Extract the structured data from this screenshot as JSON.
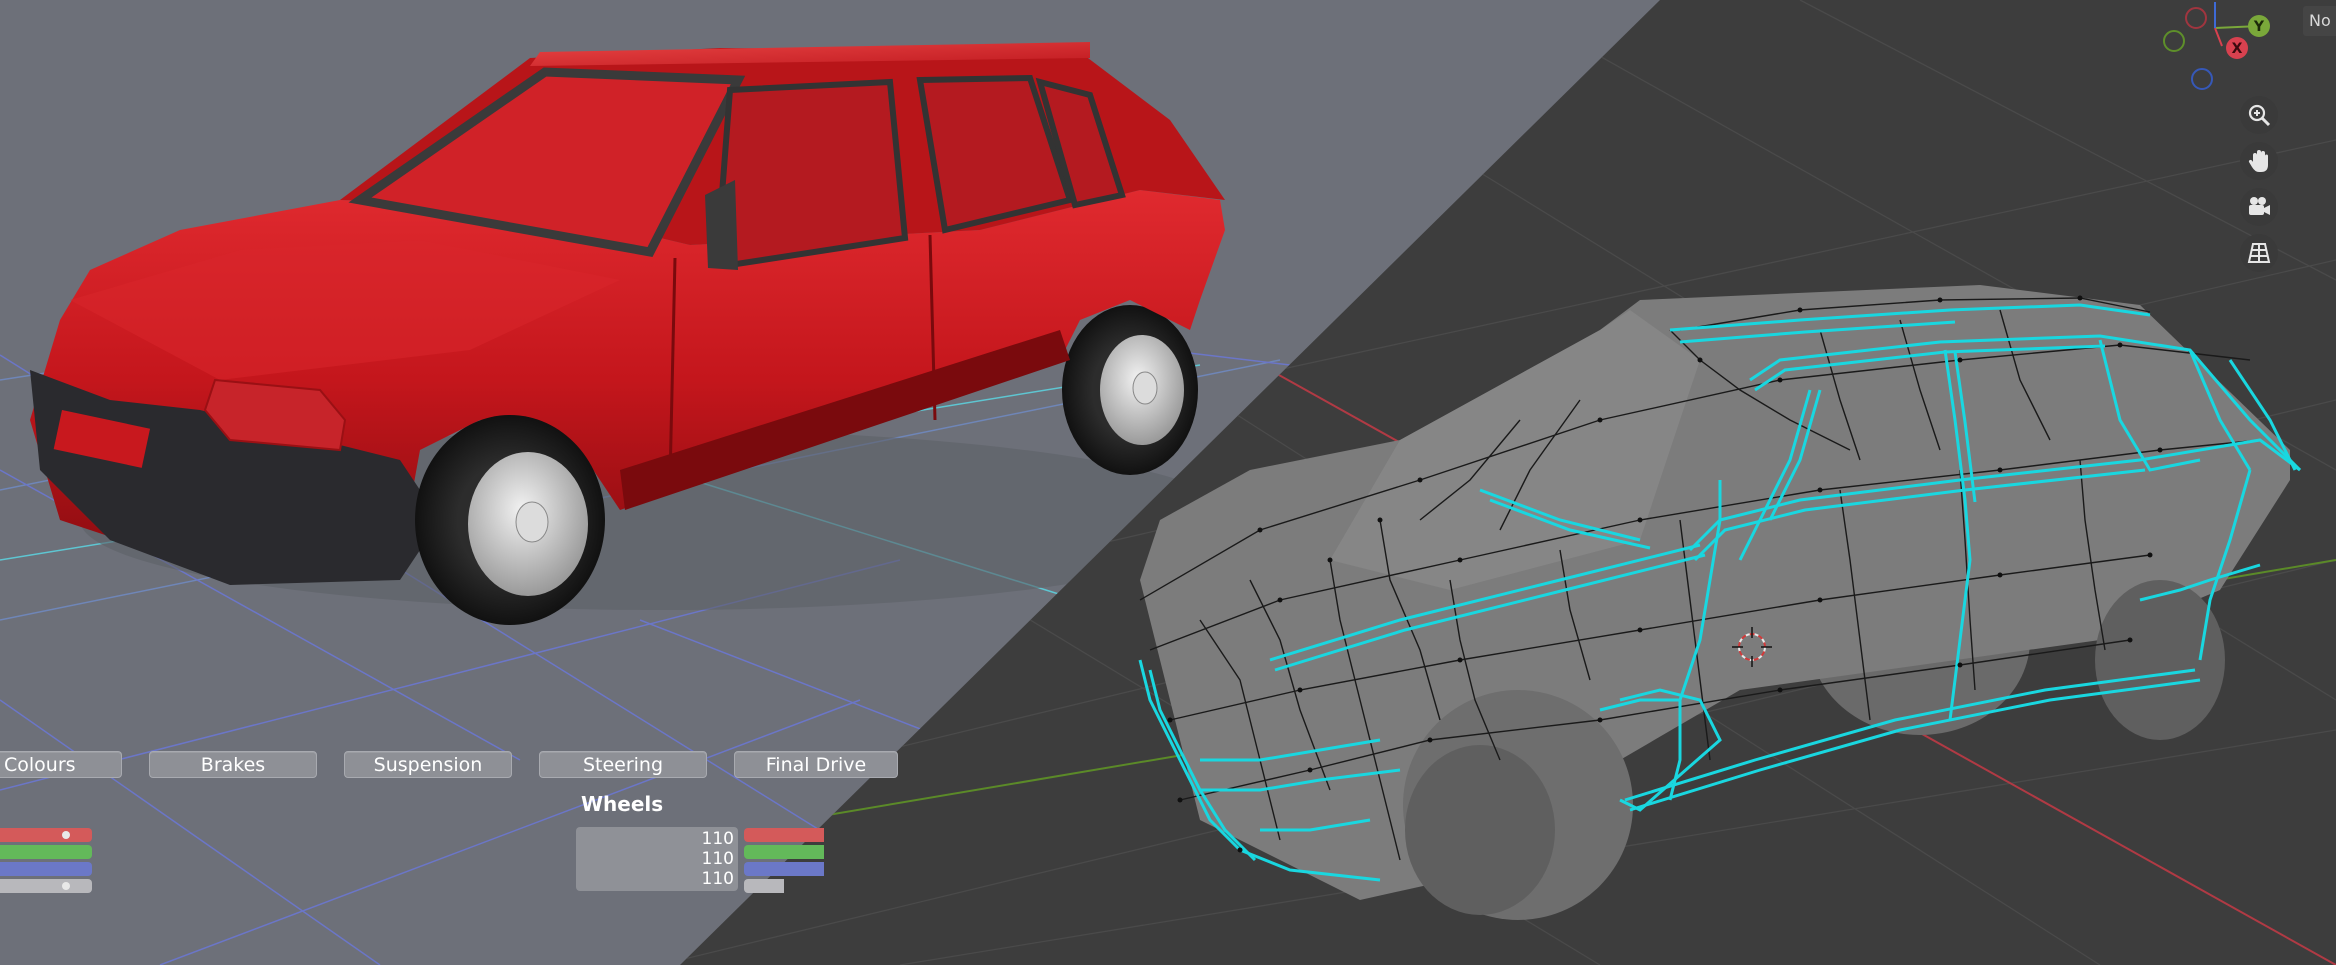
{
  "tabs": {
    "colours": "Colours",
    "brakes": "Brakes",
    "suspension": "Suspension",
    "steering": "Steering",
    "final_drive": "Final Drive"
  },
  "wheels": {
    "label": "Wheels",
    "values": [
      "110",
      "110",
      "110"
    ]
  },
  "gizmo": {
    "x_label": "X",
    "y_label": "Y"
  },
  "corner_label": "No",
  "colors": {
    "car_red": "#c4161c",
    "wire_cyan": "#19d7e0",
    "left_bg": "#6d7079",
    "right_bg": "#3d3d3d",
    "axis_red": "#e0414f",
    "axis_green": "#6fae2a",
    "axis_blue": "#3e6ad6"
  },
  "icons": [
    "zoom-icon",
    "pan-hand-icon",
    "camera-icon",
    "grid-view-icon"
  ]
}
